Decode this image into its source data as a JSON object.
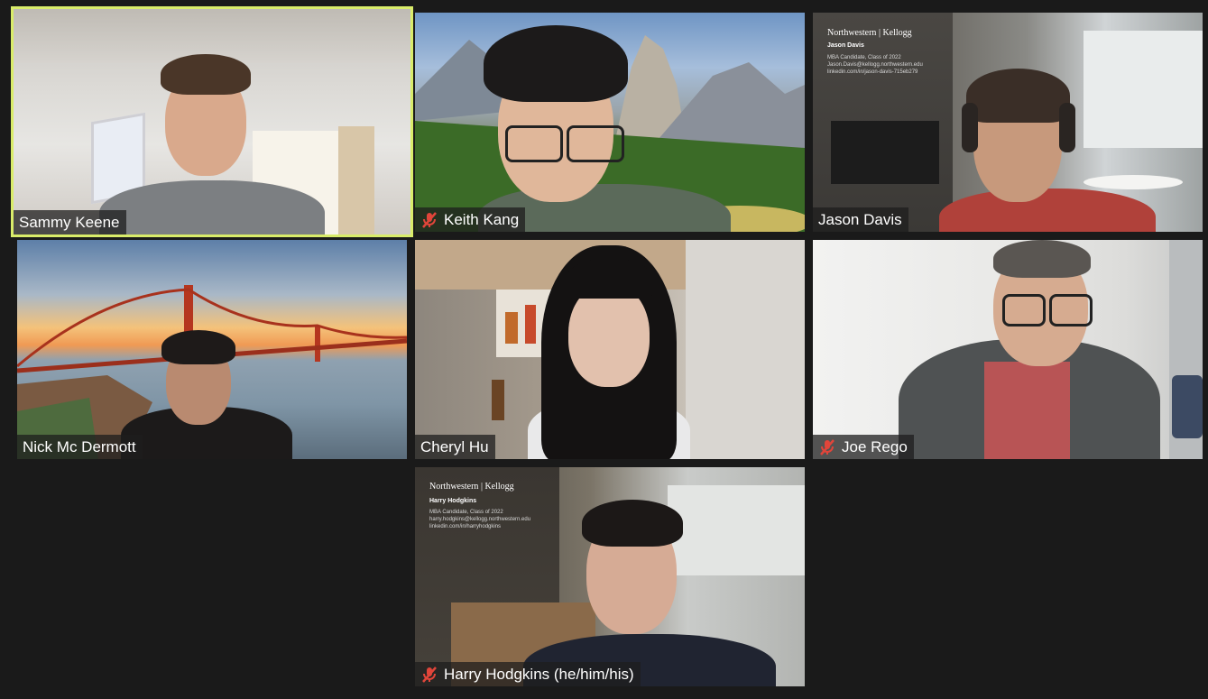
{
  "meeting": {
    "participants": [
      {
        "name": "Sammy Keene",
        "muted": false,
        "active_speaker": true
      },
      {
        "name": "Keith Kang",
        "muted": true,
        "active_speaker": false
      },
      {
        "name": "Jason Davis",
        "muted": false,
        "active_speaker": false
      },
      {
        "name": "Nick Mc Dermott",
        "muted": false,
        "active_speaker": false
      },
      {
        "name": "Cheryl Hu",
        "muted": false,
        "active_speaker": false
      },
      {
        "name": "Joe Rego",
        "muted": true,
        "active_speaker": false
      },
      {
        "name": "Harry Hodgkins (he/him/his)",
        "muted": true,
        "active_speaker": false
      }
    ]
  },
  "backgrounds": {
    "jason": {
      "logo_a": "Northwestern",
      "logo_b": "Kellogg",
      "title": "Jason Davis",
      "line1": "MBA Candidate, Class of 2022",
      "line2": "Jason.Davis@kellogg.northwestern.edu",
      "line3": "linkedin.com/in/jason-davis-715eb279"
    },
    "harry": {
      "logo_a": "Northwestern",
      "logo_b": "Kellogg",
      "title": "Harry Hodgkins",
      "line1": "MBA Candidate, Class of 2022",
      "line2": "harry.hodgkins@kellogg.northwestern.edu",
      "line3": "linkedin.com/in/harryhodgkins"
    }
  },
  "colors": {
    "active_border": "#d9ec6a",
    "mute_icon": "#e0453a",
    "background": "#1a1a1a"
  },
  "icons": {
    "mute": "microphone-muted-icon"
  }
}
